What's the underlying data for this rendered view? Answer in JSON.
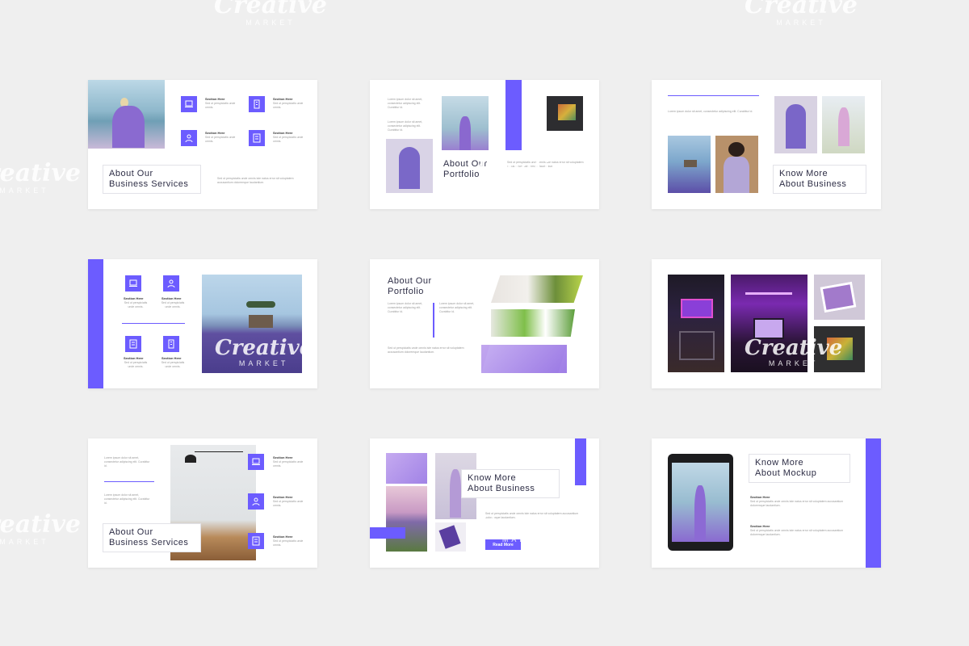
{
  "watermark": {
    "brand": "Creative",
    "sub": "MARKET"
  },
  "colors": {
    "accent": "#6c5cff",
    "background": "#efefef"
  },
  "common": {
    "section_here": "Section Here",
    "lorem_short": "Sed ut perspiciatis unde omnis.",
    "lorem_long": "Sed ut perspiciatis unde omnis iste natus error sit voluptatem accusantium doloremque laudantium.",
    "lorem_mid": "Lorem ipsum dolor sit amet, consectetur adipiscing elit. Curabitur id.",
    "read_more": "Read More"
  },
  "slides": [
    {
      "title_1": "About Our",
      "title_2": "Business Services"
    },
    {
      "title_1": "About Our",
      "title_2": "Portfolio"
    },
    {
      "title_1": "Know More",
      "title_2": "About Business"
    },
    {},
    {
      "title_1": "About Our",
      "title_2": "Portfolio"
    },
    {},
    {
      "title_1": "About Our",
      "title_2": "Business Services"
    },
    {
      "title_1": "Know More",
      "title_2": "About Business"
    },
    {
      "title_1": "Know More",
      "title_2": "About Mockup"
    }
  ]
}
